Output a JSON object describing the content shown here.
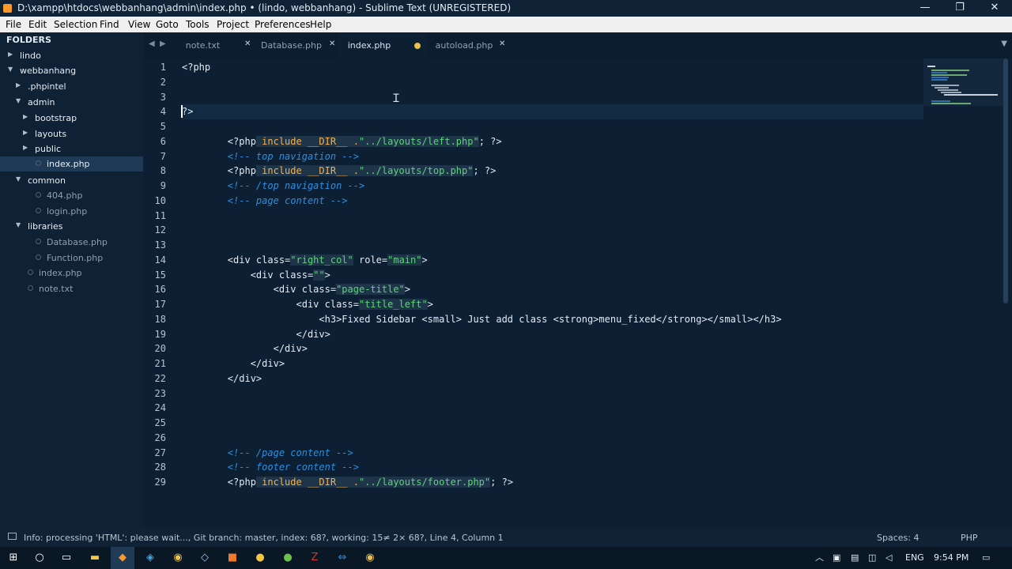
{
  "window": {
    "title": "D:\\xampp\\htdocs\\webbanhang\\admin\\index.php • (lindo, webbanhang) - Sublime Text (UNREGISTERED)",
    "minimize": "—",
    "maximize": "❐",
    "close": "✕"
  },
  "menu": [
    "File",
    "Edit",
    "Selection",
    "Find",
    "View",
    "Goto",
    "Tools",
    "Project",
    "Preferences",
    "Help"
  ],
  "sidebar": {
    "header": "FOLDERS",
    "items": [
      {
        "label": "lindo",
        "kind": "folder",
        "state": "collapsed"
      },
      {
        "label": "webbanhang",
        "kind": "folder",
        "state": "expanded"
      },
      {
        "label": ".phpintel",
        "kind": "folder",
        "state": "collapsed"
      },
      {
        "label": "admin",
        "kind": "folder",
        "state": "expanded"
      },
      {
        "label": "bootstrap",
        "kind": "folder",
        "state": "collapsed"
      },
      {
        "label": "layouts",
        "kind": "folder",
        "state": "collapsed"
      },
      {
        "label": "public",
        "kind": "folder",
        "state": "collapsed"
      },
      {
        "label": "index.php",
        "kind": "file",
        "selected": true
      },
      {
        "label": "common",
        "kind": "folder",
        "state": "expanded"
      },
      {
        "label": "404.php",
        "kind": "file"
      },
      {
        "label": "login.php",
        "kind": "file"
      },
      {
        "label": "libraries",
        "kind": "folder",
        "state": "expanded"
      },
      {
        "label": "Database.php",
        "kind": "file"
      },
      {
        "label": "Function.php",
        "kind": "file"
      },
      {
        "label": "index.php",
        "kind": "file"
      },
      {
        "label": "note.txt",
        "kind": "file"
      }
    ]
  },
  "tabs": [
    {
      "label": "note.txt",
      "state": "close"
    },
    {
      "label": "Database.php",
      "state": "close"
    },
    {
      "label": "index.php",
      "state": "dirty",
      "active": true
    },
    {
      "label": "autoload.php",
      "state": "close"
    }
  ],
  "tab_nav": {
    "prev": "◀",
    "next": "▶",
    "menu": "▼"
  },
  "editor": {
    "cursor_line": 4,
    "lines": [
      {
        "n": "1",
        "tokens": [
          {
            "t": "<?php",
            "c": "tag"
          }
        ]
      },
      {
        "n": "2",
        "tokens": []
      },
      {
        "n": "3",
        "tokens": []
      },
      {
        "n": "4",
        "tokens": [
          {
            "t": "?>",
            "c": "tag"
          }
        ]
      },
      {
        "n": "5",
        "tokens": []
      },
      {
        "n": "6",
        "tokens": [
          {
            "t": "        <?php",
            "c": "tag"
          },
          {
            "t": " include __DIR__ .",
            "c": "kw"
          },
          {
            "t": "\"../layouts/left.php\"",
            "c": "str"
          },
          {
            "t": "; ?>",
            "c": "tag"
          }
        ]
      },
      {
        "n": "7",
        "tokens": [
          {
            "t": "        <!-- top navigation -->",
            "c": "cmt"
          }
        ]
      },
      {
        "n": "8",
        "tokens": [
          {
            "t": "        <?php",
            "c": "tag"
          },
          {
            "t": " include __DIR__ .",
            "c": "kw"
          },
          {
            "t": "\"../layouts/top.php\"",
            "c": "str"
          },
          {
            "t": "; ?>",
            "c": "tag"
          }
        ]
      },
      {
        "n": "9",
        "tokens": [
          {
            "t": "        <!-- /top navigation -->",
            "c": "cmt"
          }
        ]
      },
      {
        "n": "10",
        "tokens": [
          {
            "t": "        <!-- page content -->",
            "c": "cmt"
          }
        ]
      },
      {
        "n": "11",
        "tokens": []
      },
      {
        "n": "12",
        "tokens": []
      },
      {
        "n": "13",
        "tokens": []
      },
      {
        "n": "14",
        "tokens": [
          {
            "t": "        <div class=",
            "c": "tag"
          },
          {
            "t": "\"right_col\"",
            "c": "str"
          },
          {
            "t": " role=",
            "c": "tag"
          },
          {
            "t": "\"main\"",
            "c": "str"
          },
          {
            "t": ">",
            "c": "tag"
          }
        ]
      },
      {
        "n": "15",
        "tokens": [
          {
            "t": "            <div class=",
            "c": "tag"
          },
          {
            "t": "\"\"",
            "c": "str"
          },
          {
            "t": ">",
            "c": "tag"
          }
        ]
      },
      {
        "n": "16",
        "tokens": [
          {
            "t": "                <div class=",
            "c": "tag"
          },
          {
            "t": "\"page-title\"",
            "c": "str"
          },
          {
            "t": ">",
            "c": "tag"
          }
        ]
      },
      {
        "n": "17",
        "tokens": [
          {
            "t": "                    <div class=",
            "c": "tag"
          },
          {
            "t": "\"title_left\"",
            "c": "str"
          },
          {
            "t": ">",
            "c": "tag"
          }
        ]
      },
      {
        "n": "18",
        "tokens": [
          {
            "t": "                        <h3>Fixed Sidebar <small> Just add class <strong>menu_fixed</strong></small></h3>",
            "c": "tag"
          }
        ]
      },
      {
        "n": "19",
        "tokens": [
          {
            "t": "                    </div>",
            "c": "tag"
          }
        ]
      },
      {
        "n": "20",
        "tokens": [
          {
            "t": "                </div>",
            "c": "tag"
          }
        ]
      },
      {
        "n": "21",
        "tokens": [
          {
            "t": "            </div>",
            "c": "tag"
          }
        ]
      },
      {
        "n": "22",
        "tokens": [
          {
            "t": "        </div>",
            "c": "tag"
          }
        ]
      },
      {
        "n": "23",
        "tokens": []
      },
      {
        "n": "24",
        "tokens": []
      },
      {
        "n": "25",
        "tokens": []
      },
      {
        "n": "26",
        "tokens": []
      },
      {
        "n": "27",
        "tokens": [
          {
            "t": "        <!-- /page content -->",
            "c": "cmt"
          }
        ]
      },
      {
        "n": "28",
        "tokens": [
          {
            "t": "        <!-- footer content -->",
            "c": "cmt"
          }
        ]
      },
      {
        "n": "29",
        "tokens": [
          {
            "t": "        <?php",
            "c": "tag"
          },
          {
            "t": " include __DIR__ .",
            "c": "kw"
          },
          {
            "t": "\"../layouts/footer.php\"",
            "c": "str"
          },
          {
            "t": "; ?>",
            "c": "tag"
          }
        ]
      }
    ]
  },
  "status": {
    "message": "Info: processing 'HTML': please wait..., Git branch: master, index: 68?, working: 15≠ 2× 68?, Line 4, Column 1",
    "spaces": "Spaces: 4",
    "syntax": "PHP"
  },
  "taskbar": {
    "apps": [
      "windows-start-icon",
      "search-circle-icon",
      "task-view-icon",
      "file-explorer-icon",
      "sublime-text-icon",
      "app-icon",
      "chrome-icon",
      "app-icon",
      "app-icon",
      "app-icon",
      "app-icon",
      "filezilla-icon",
      "teamviewer-icon",
      "chrome-icon"
    ],
    "language": "ENG",
    "time": "9:54 PM"
  },
  "colors": {
    "editor_bg": "#0d1f33",
    "sidebar_bg": "#0e2135",
    "keyword": "#f7b14a",
    "string": "#5fd37a",
    "comment": "#2d8fe0",
    "dirty_dot": "#e8c04a"
  }
}
